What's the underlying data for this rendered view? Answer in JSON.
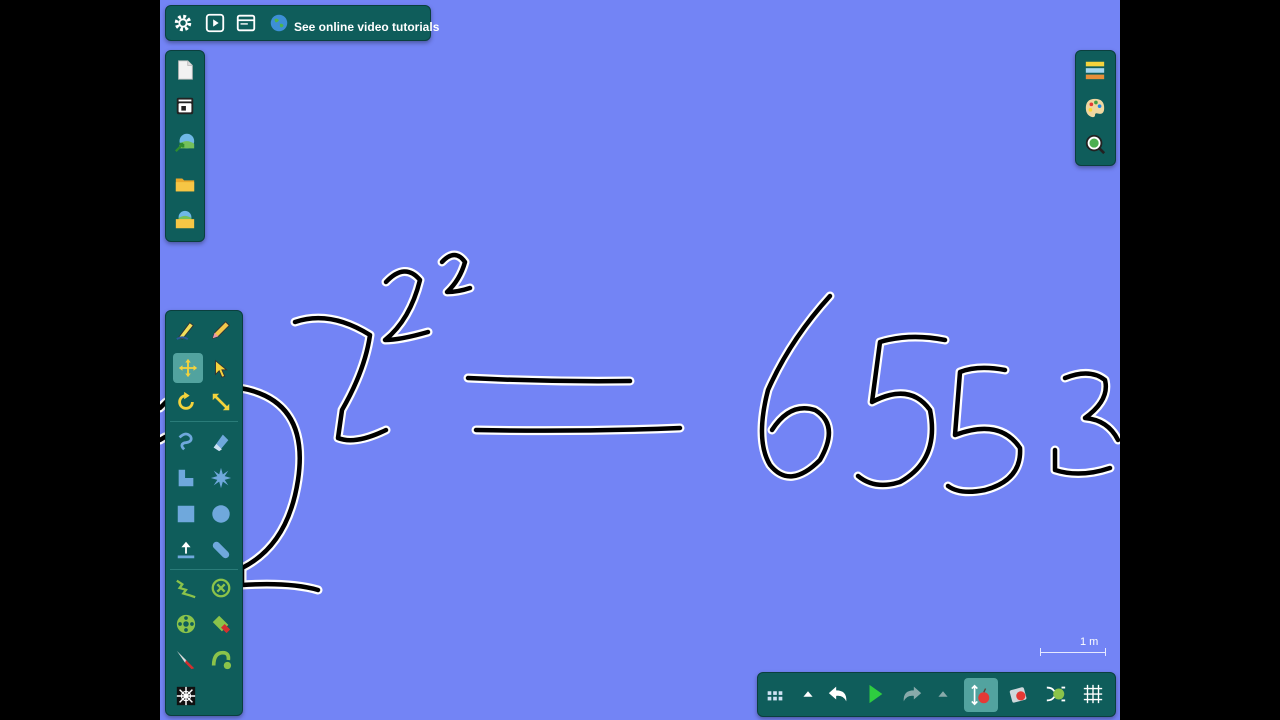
{
  "top_bar": {
    "tutorials_label": "See online video tutorials",
    "icons": [
      "settings-icon",
      "play-icon",
      "window-icon",
      "globe-icon"
    ]
  },
  "file_panel": {
    "icons": [
      "new-page-icon",
      "archive-icon",
      "export-image-icon",
      "folder-icon",
      "open-image-folder-icon"
    ]
  },
  "right_panel": {
    "icons": [
      "layers-icon",
      "palette-icon",
      "zoom-icon"
    ]
  },
  "tools_panel": {
    "selected_tool": "move",
    "icons": [
      "pen-icon",
      "pencil-icon",
      "move-icon",
      "pointer-hand-icon",
      "rotate-icon",
      "resize-icon",
      "curve-icon",
      "eraser-icon",
      "shape-l-icon",
      "star-burst-icon",
      "rectangle-icon",
      "circle-icon",
      "upload-icon",
      "bandage-icon",
      "zigzag-icon",
      "cancel-icon",
      "spool-icon",
      "fill-icon",
      "knife-icon",
      "rope-icon",
      "spiral-icon"
    ]
  },
  "bottom_bar": {
    "icons": [
      "grid-dots-icon",
      "expand-up-icon",
      "undo-icon",
      "play-icon",
      "redo-icon",
      "expand-up-icon",
      "gravity-icon",
      "physics-object-icon",
      "connect-icon",
      "grid-icon"
    ]
  },
  "scale_bar": {
    "label": "1 m"
  },
  "colors": {
    "canvas": "#7384f5",
    "panel": "#0f5d5b",
    "ink": "#000000"
  }
}
